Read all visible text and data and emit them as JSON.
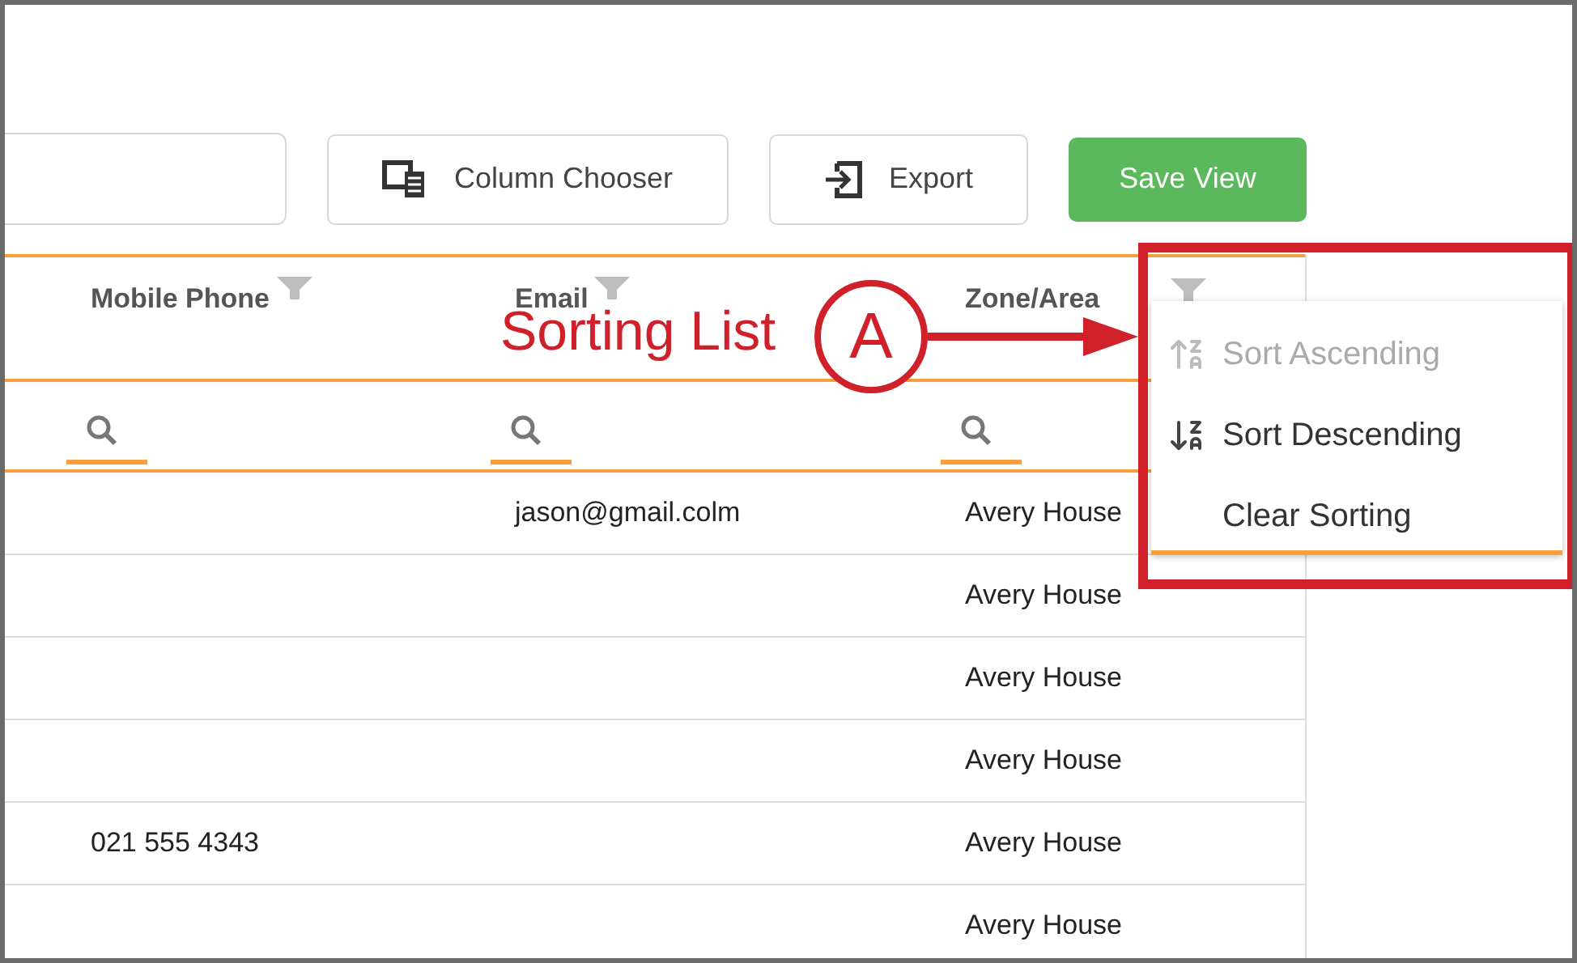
{
  "toolbar": {
    "buttons": [
      {
        "label": "Column Chooser",
        "kind": "columns"
      },
      {
        "label": "Export",
        "kind": "export"
      },
      {
        "label": "Save View",
        "kind": "primary"
      }
    ]
  },
  "table": {
    "columns": [
      {
        "label": "Mobile Phone"
      },
      {
        "label": "Email"
      },
      {
        "label": "Zone/Area"
      }
    ],
    "rows": [
      {
        "email": "jason@gmail.colm",
        "zone_area": "Avery House"
      },
      {
        "zone_area": "Avery House"
      },
      {
        "zone_area": "Avery House"
      },
      {
        "zone_area": "Avery House"
      },
      {
        "mobile_phone": "021 555 4343",
        "zone_area": "Avery House"
      },
      {
        "zone_area": "Avery House"
      }
    ]
  },
  "sort_menu": {
    "items": [
      {
        "label": "Sort Ascending",
        "kind": "ascending",
        "disabled": true
      },
      {
        "label": "Sort Descending",
        "kind": "descending",
        "disabled": false
      },
      {
        "label": "Clear Sorting",
        "kind": "clear",
        "disabled": false
      }
    ]
  },
  "annotation": {
    "label": "Sorting List",
    "marker": "A"
  }
}
